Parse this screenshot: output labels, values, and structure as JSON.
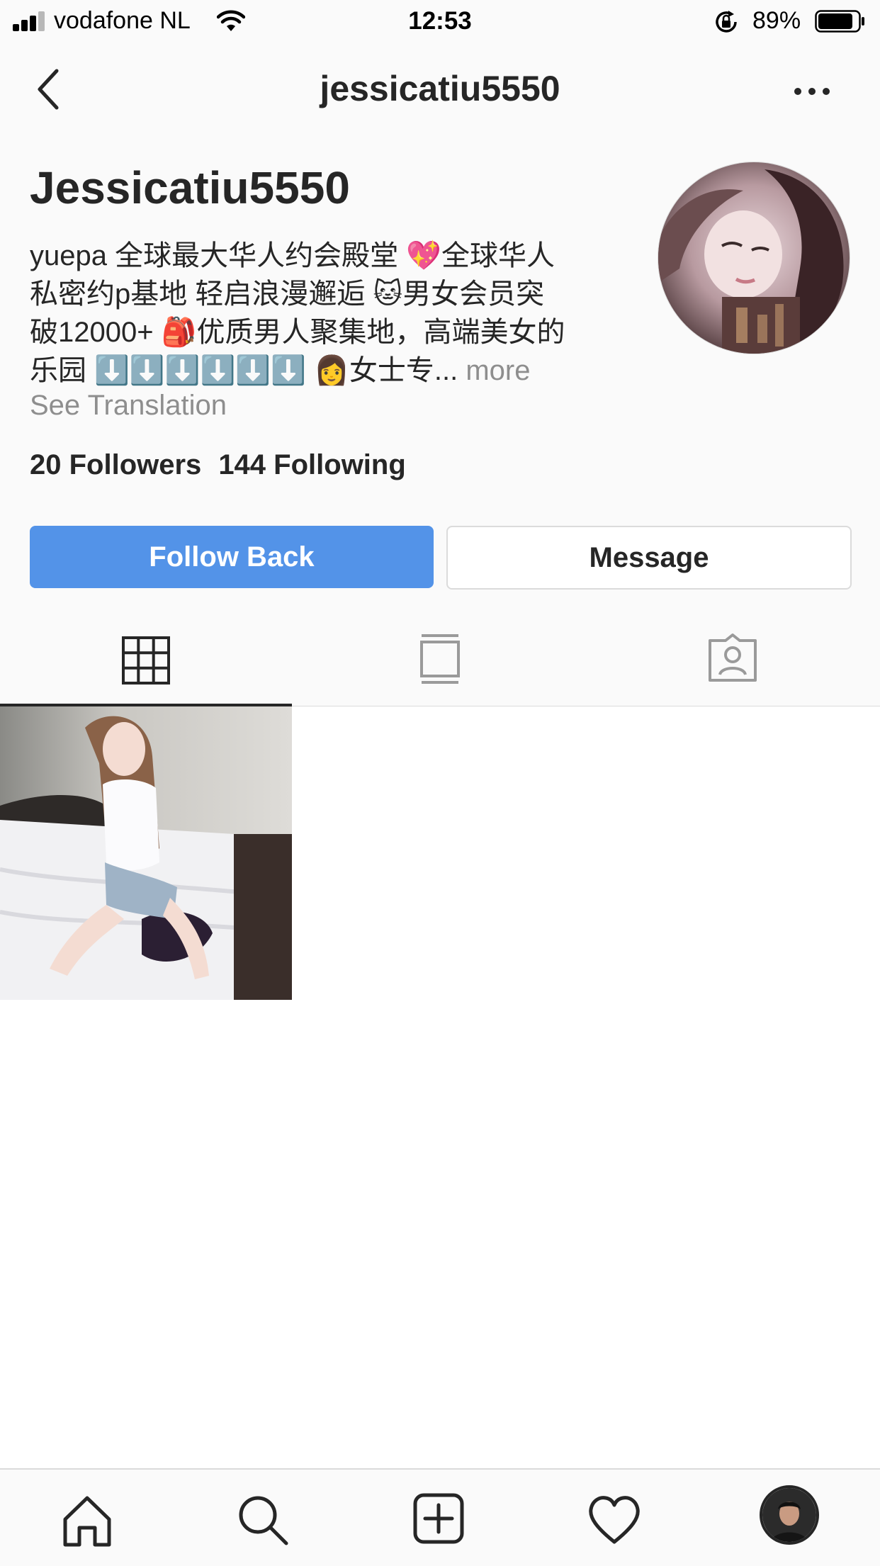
{
  "status_bar": {
    "carrier": "vodafone NL",
    "time": "12:53",
    "battery_percent": "89%",
    "battery_level": 0.89,
    "signal_bars": 3,
    "icons": [
      "signal-icon",
      "wifi-icon",
      "rotation-lock-icon",
      "battery-icon"
    ]
  },
  "nav": {
    "title": "jessicatiu5550",
    "back_icon": "chevron-left-icon",
    "more_icon": "more-horizontal-icon"
  },
  "profile": {
    "display_name": "Jessicatiu5550",
    "bio": "yuepa 全球最大华人约会殿堂 💖全球华人\n私密约p基地 轻启浪漫邂逅 🐱男女会员突\n破12000+ 🎒优质男人聚集地，高端美女的\n乐园 ⬇️⬇️⬇️⬇️⬇️⬇️ 👩女士专...",
    "bio_more": " more",
    "see_translation": "See Translation",
    "followers": "20 Followers",
    "following": "144 Following",
    "follow_button": "Follow Back",
    "message_button": "Message"
  },
  "tabs": [
    {
      "icon": "grid-icon",
      "active": true
    },
    {
      "icon": "feed-list-icon",
      "active": false
    },
    {
      "icon": "tagged-person-icon",
      "active": false
    }
  ],
  "posts": [
    {
      "type": "photo"
    }
  ],
  "bottom_bar": [
    {
      "icon": "home-icon"
    },
    {
      "icon": "search-icon"
    },
    {
      "icon": "add-post-icon"
    },
    {
      "icon": "heart-icon"
    },
    {
      "icon": "profile-avatar-icon"
    }
  ],
  "colors": {
    "primary_button": "#5393e8",
    "text": "#262626",
    "secondary_text": "#8e8e8e",
    "background": "#fafafa",
    "divider": "#dbdbdb"
  }
}
